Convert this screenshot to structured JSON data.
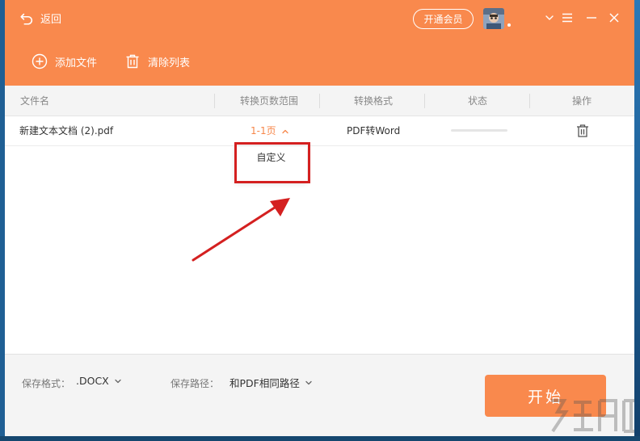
{
  "header": {
    "back_label": "返回",
    "vip_label": "开通会员"
  },
  "toolbar": {
    "add_file_label": "添加文件",
    "clear_list_label": "清除列表"
  },
  "table": {
    "columns": [
      "文件名",
      "转换页数范围",
      "转换格式",
      "状态",
      "操作"
    ],
    "rows": [
      {
        "filename": "新建文本文档 (2).pdf",
        "page_range": "1-1页",
        "format": "PDF转Word",
        "progress": 0
      }
    ]
  },
  "dropdown": {
    "options": [
      "自定义"
    ]
  },
  "footer": {
    "format_label": "保存格式：",
    "format_value": ".DOCX",
    "path_label": "保存路径：",
    "path_value": "和PDF相同路径",
    "start_label": "开始"
  },
  "colors": {
    "accent": "#f9894d",
    "highlight": "#d42020"
  }
}
